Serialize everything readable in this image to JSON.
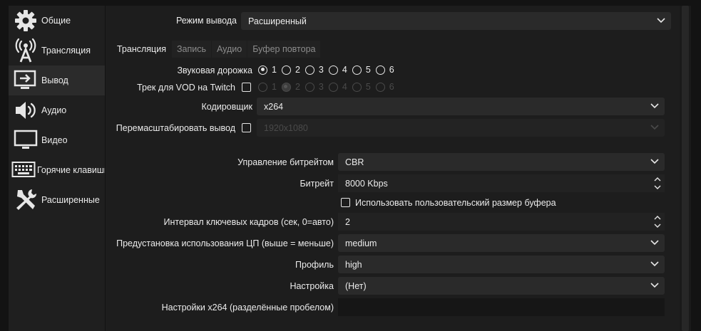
{
  "sidebar": {
    "items": [
      {
        "label": "Общие",
        "icon": "gear-icon"
      },
      {
        "label": "Трансляция",
        "icon": "broadcast-icon"
      },
      {
        "label": "Вывод",
        "icon": "output-icon"
      },
      {
        "label": "Аудио",
        "icon": "speaker-icon"
      },
      {
        "label": "Видео",
        "icon": "monitor-icon"
      },
      {
        "label": "Горячие клавиши",
        "icon": "keyboard-icon"
      },
      {
        "label": "Расширенные",
        "icon": "tools-icon"
      }
    ],
    "active_index": 2
  },
  "output_mode": {
    "label": "Режим вывода",
    "value": "Расширенный"
  },
  "tabs": [
    "Трансляция",
    "Запись",
    "Аудио",
    "Буфер повтора"
  ],
  "audio_track": {
    "label": "Звуковая дорожка",
    "options": [
      "1",
      "2",
      "3",
      "4",
      "5",
      "6"
    ],
    "selected": "1"
  },
  "vod_track": {
    "label": "Трек для VOD на Twitch",
    "checked": false,
    "options": [
      "1",
      "2",
      "3",
      "4",
      "5",
      "6"
    ],
    "selected": "2"
  },
  "encoder": {
    "label": "Кодировщик",
    "value": "x264"
  },
  "rescale": {
    "label": "Перемасштабировать вывод",
    "checked": false,
    "value": "1920x1080"
  },
  "rate_control": {
    "label": "Управление битрейтом",
    "value": "CBR"
  },
  "bitrate": {
    "label": "Битрейт",
    "value": "8000 Kbps"
  },
  "custom_buffer": {
    "label": "Использовать пользовательский размер буфера",
    "checked": false
  },
  "keyframe": {
    "label": "Интервал ключевых кадров (сек, 0=авто)",
    "value": "2"
  },
  "cpu_preset": {
    "label": "Предустановка использования ЦП (выше = меньше)",
    "value": "medium"
  },
  "profile": {
    "label": "Профиль",
    "value": "high"
  },
  "tune": {
    "label": "Настройка",
    "value": "(Нет)"
  },
  "x264_opts": {
    "label": "Настройки x264 (разделённые пробелом)",
    "value": ""
  }
}
